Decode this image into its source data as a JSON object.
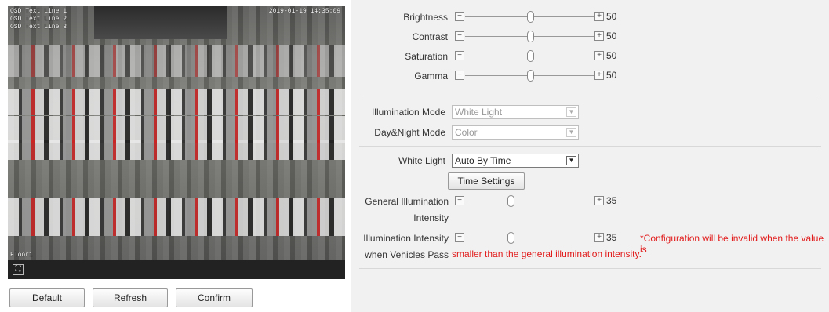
{
  "video": {
    "overlay_lines": [
      "OSD Text Line 1",
      "OSD Text Line 2",
      "OSD Text Line 3"
    ],
    "timestamp": "2019-01-19 14:35:09",
    "bottom_label": "Floor1",
    "fullscreen_icon": "fullscreen-icon"
  },
  "buttons": {
    "default": "Default",
    "refresh": "Refresh",
    "confirm": "Confirm"
  },
  "image_sliders": [
    {
      "label": "Brightness",
      "value": "50",
      "level": 0.5
    },
    {
      "label": "Contrast",
      "value": "50",
      "level": 0.5
    },
    {
      "label": "Saturation",
      "value": "50",
      "level": 0.5
    },
    {
      "label": "Gamma",
      "value": "50",
      "level": 0.5
    }
  ],
  "illumination_mode": {
    "label": "Illumination Mode",
    "value": "White Light"
  },
  "day_night_mode": {
    "label": "Day&Night Mode",
    "value": "Color"
  },
  "white_light": {
    "label": "White Light",
    "value": "Auto By Time"
  },
  "time_settings_button": "Time Settings",
  "general_illumination": {
    "label_line1": "General Illumination",
    "label_line2": "Intensity",
    "value": "35",
    "level": 0.35
  },
  "vehicle_illumination": {
    "label_line1": "Illumination Intensity",
    "label_line2": "when Vehicles Pass",
    "value": "35",
    "level": 0.35
  },
  "warning": {
    "line1": "*Configuration will be invalid when the value is",
    "line2": "smaller than the general illumination intensity."
  },
  "icons": {
    "minus": "−",
    "plus": "+",
    "dropdown": "▼",
    "fullscreen": "⛶"
  }
}
